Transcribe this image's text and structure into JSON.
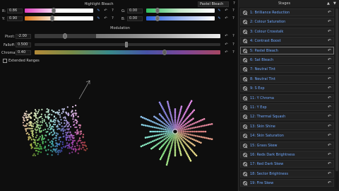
{
  "header": {
    "title": "Highlight Bleach",
    "preset": "Pastel Bleach",
    "help": "?"
  },
  "hue_controls": [
    {
      "label": "R:",
      "value": "0.86",
      "gradient": "linear-gradient(90deg,#e040c0,#ffffff,#ffffff)"
    },
    {
      "label": "Y:",
      "value": "0.90",
      "gradient": "linear-gradient(90deg,#e07a1a,#ffffff,#ffffff)"
    },
    {
      "label": "G:",
      "value": "0.00",
      "gradient": "linear-gradient(90deg,#30c060,#c8e8cc,#ffffff)"
    },
    {
      "label": "B:",
      "value": "0.00",
      "gradient": "linear-gradient(90deg,#2a60e0,#9fb8f0,#ffffff)"
    }
  ],
  "modulation": {
    "title": "Modulation",
    "rows": [
      {
        "label": "Pivot:",
        "value": "-2.00"
      },
      {
        "label": "Falloff:",
        "value": "0.500"
      },
      {
        "label": "Chroma:",
        "value": "0.40"
      }
    ]
  },
  "extended_ranges": "Extended Ranges",
  "stages": {
    "title": "Stages",
    "up": "▲",
    "down": "▼",
    "items": [
      "1: Brilliance Reduction",
      "2: Colour Saturation",
      "3: Colour Crosstalk",
      "4: Contrast Boost",
      "5: Pastel Bleach",
      "6: Sat Bleach",
      "7: Neutral Tint",
      "8: Neutral Tint",
      "9: S Exp",
      "11: Y Chroma",
      "11: Y Exp",
      "12: Thermal Squash",
      "13: Skin Shine",
      "14: Skin Saturation",
      "15: Grass Skew",
      "16: Reds Dark Brightness",
      "17: Red Dark Skew",
      "18: Sector Brightness",
      "19: Fire Skew"
    ],
    "active_index": 4
  },
  "icons": {
    "eyedropper": "eyedropper-icon",
    "reset": "reset-icon",
    "help": "help-icon",
    "disable": "disable-icon"
  },
  "colors": {
    "accent_blue": "#6fa8ff",
    "panel_bg": "#0e0e0e",
    "stage_bg": "#222222"
  }
}
